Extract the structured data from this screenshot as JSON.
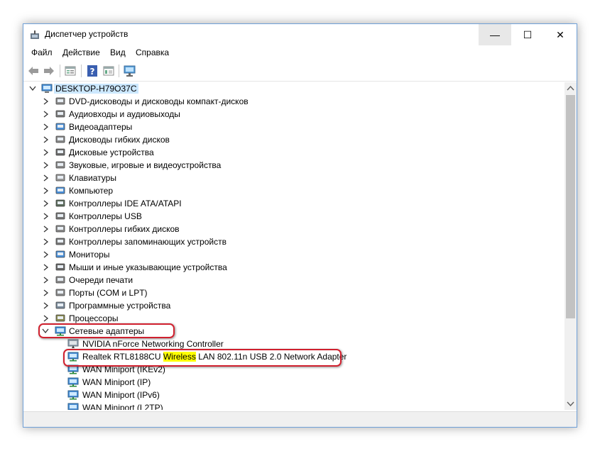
{
  "window": {
    "title": "Диспетчер устройств",
    "min_glyph": "—",
    "max_glyph": "☐",
    "close_glyph": "✕"
  },
  "menu": {
    "file": "Файл",
    "action": "Действие",
    "view": "Вид",
    "help": "Справка"
  },
  "tree": {
    "root": "DESKTOP-H79O37C",
    "categories": [
      "DVD-дисководы и дисководы компакт-дисков",
      "Аудиовходы и аудиовыходы",
      "Видеоадаптеры",
      "Дисководы гибких дисков",
      "Дисковые устройства",
      "Звуковые, игровые и видеоустройства",
      "Клавиатуры",
      "Компьютер",
      "Контроллеры IDE ATA/ATAPI",
      "Контроллеры USB",
      "Контроллеры гибких дисков",
      "Контроллеры запоминающих устройств",
      "Мониторы",
      "Мыши и иные указывающие устройства",
      "Очереди печати",
      "Порты (COM и LPT)",
      "Программные устройства",
      "Процессоры"
    ],
    "network_category": "Сетевые адаптеры",
    "adapters": {
      "nvidia": "NVIDIA nForce Networking Controller",
      "realtek_pre": "Realtek RTL8188CU ",
      "realtek_hl": "Wireless",
      "realtek_post": " LAN 802.11n USB 2.0 Network Adapter",
      "wan_ikev2": "WAN Miniport (IKEv2)",
      "wan_ip": "WAN Miniport (IP)",
      "wan_ipv6": "WAN Miniport (IPv6)",
      "wan_l2tp": "WAN Miniport (L2TP)"
    }
  },
  "colors": {
    "accent": "#0078d7",
    "highlight_ring": "#d0202e",
    "selection": "#cce8ff",
    "text_highlight": "#ffff00"
  }
}
